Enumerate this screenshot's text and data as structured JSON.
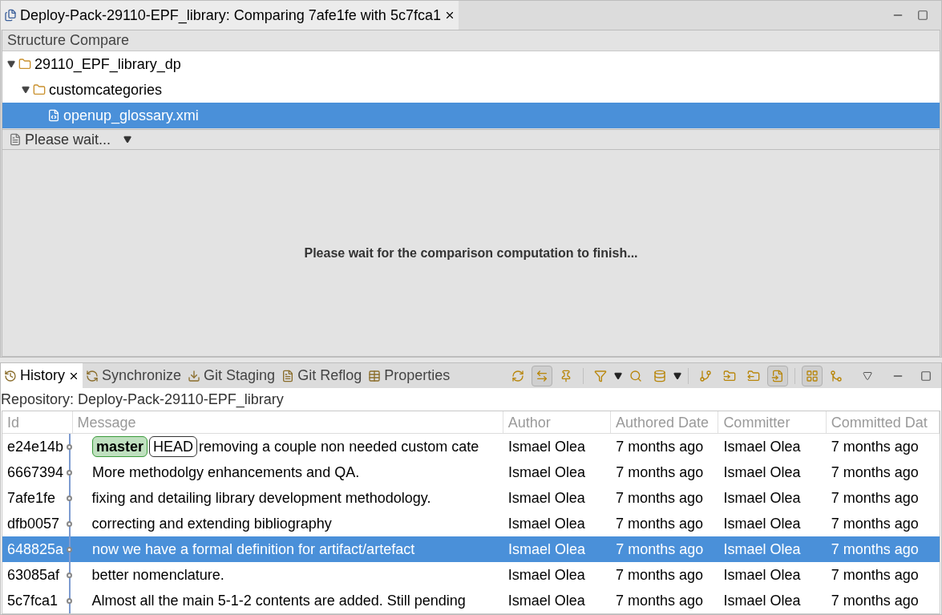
{
  "editor": {
    "title": "Deploy-Pack-29110-EPF_library: Comparing 7afe1fe with 5c7fca1",
    "structure_header": "Structure Compare",
    "tree": [
      {
        "label": "29110_EPF_library_dp",
        "kind": "folder",
        "expanded": true,
        "selected": false,
        "children": [
          {
            "label": "customcategories",
            "kind": "folder",
            "expanded": true,
            "selected": false,
            "children": [
              {
                "label": "openup_glossary.xmi",
                "kind": "file",
                "selected": true
              }
            ]
          }
        ]
      }
    ],
    "viewer_label": "Please wait...",
    "message": "Please wait for the comparison computation to finish..."
  },
  "history": {
    "tabs": [
      {
        "label": "History",
        "kind": "history",
        "selected": true
      },
      {
        "label": "Synchronize",
        "kind": "sync",
        "selected": false
      },
      {
        "label": "Git Staging",
        "kind": "staging",
        "selected": false
      },
      {
        "label": "Git Reflog",
        "kind": "reflog",
        "selected": false
      },
      {
        "label": "Properties",
        "kind": "properties",
        "selected": false
      }
    ],
    "toolbar": [
      {
        "kind": "refresh",
        "pressed": false
      },
      {
        "kind": "link",
        "pressed": true
      },
      {
        "kind": "pin",
        "pressed": false
      },
      {
        "kind": "sep"
      },
      {
        "kind": "filter",
        "pressed": false
      },
      {
        "kind": "dropdown"
      },
      {
        "kind": "search",
        "pressed": false
      },
      {
        "kind": "repo",
        "pressed": false
      },
      {
        "kind": "dropdown"
      },
      {
        "kind": "sep"
      },
      {
        "kind": "branches",
        "pressed": false
      },
      {
        "kind": "folder-in",
        "pressed": false
      },
      {
        "kind": "folder-out",
        "pressed": false
      },
      {
        "kind": "file-in",
        "pressed": true
      },
      {
        "kind": "sep"
      },
      {
        "kind": "layout",
        "pressed": true
      },
      {
        "kind": "merge",
        "pressed": false
      }
    ],
    "repository": "Repository: Deploy-Pack-29110-EPF_library",
    "columns": [
      "Id",
      "Message",
      "Author",
      "Authored Date",
      "Committer",
      "Committed Dat"
    ],
    "rows": [
      {
        "id": "e24e14b",
        "refs": [
          {
            "label": "master",
            "kind": "branch"
          },
          {
            "label": "HEAD",
            "kind": "head"
          }
        ],
        "message": "removing a couple non needed custom cate",
        "author": "Ismael Olea",
        "authored": "7 months ago",
        "committer": "Ismael Olea",
        "committed": "7 months ago",
        "selected": false
      },
      {
        "id": "6667394",
        "message": "More methodolgy enhancements and QA.",
        "author": "Ismael Olea",
        "authored": "7 months ago",
        "committer": "Ismael Olea",
        "committed": "7 months ago",
        "selected": false
      },
      {
        "id": "7afe1fe",
        "message": "fixing and detailing library development methodology.",
        "author": "Ismael Olea",
        "authored": "7 months ago",
        "committer": "Ismael Olea",
        "committed": "7 months ago",
        "selected": false
      },
      {
        "id": "dfb0057",
        "message": "correcting and extending bibliography",
        "author": "Ismael Olea",
        "authored": "7 months ago",
        "committer": "Ismael Olea",
        "committed": "7 months ago",
        "selected": false
      },
      {
        "id": "648825a",
        "message": "now we have a formal definition for artifact/artefact",
        "author": "Ismael Olea",
        "authored": "7 months ago",
        "committer": "Ismael Olea",
        "committed": "7 months ago",
        "selected": true
      },
      {
        "id": "63085af",
        "message": "better nomenclature.",
        "author": "Ismael Olea",
        "authored": "7 months ago",
        "committer": "Ismael Olea",
        "committed": "7 months ago",
        "selected": false
      },
      {
        "id": "5c7fca1",
        "message": "Almost all the main 5-1-2 contents are added. Still pending",
        "author": "Ismael Olea",
        "authored": "7 months ago",
        "committer": "Ismael Olea",
        "committed": "7 months ago",
        "selected": false
      }
    ]
  }
}
